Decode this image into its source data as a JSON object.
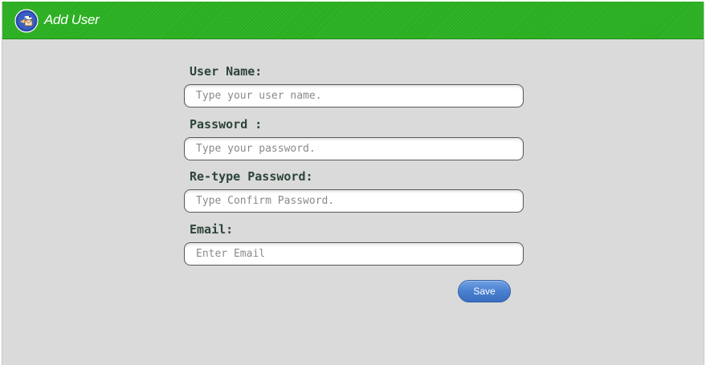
{
  "header": {
    "title": "Add User",
    "logo_icon": "bird-mail-icon",
    "background_color": "#27ad1d"
  },
  "form": {
    "fields": [
      {
        "label": "User Name:",
        "placeholder": "Type your user name.",
        "value": ""
      },
      {
        "label": "Password :",
        "placeholder": "Type your password.",
        "value": ""
      },
      {
        "label": "Re-type Password:",
        "placeholder": "Type Confirm Password.",
        "value": ""
      },
      {
        "label": "Email:",
        "placeholder": "Enter Email",
        "value": ""
      }
    ],
    "save_label": "Save",
    "label_color": "#2d4438",
    "button_color": "#4a80d0"
  }
}
